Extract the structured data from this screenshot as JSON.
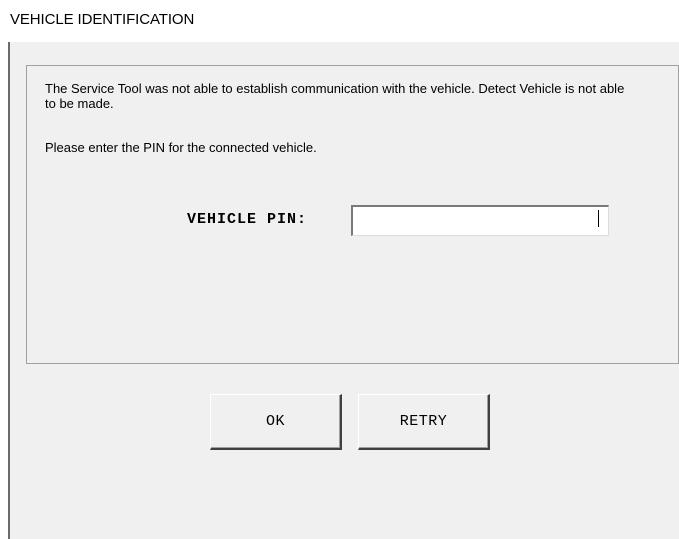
{
  "window": {
    "title": "VEHICLE IDENTIFICATION"
  },
  "message": {
    "line1": "The Service Tool was not able to establish communication with the vehicle. Detect Vehicle is not able to be made.",
    "line2": "Please enter the PIN for the connected vehicle."
  },
  "pin": {
    "label": "VEHICLE PIN:",
    "value": ""
  },
  "buttons": {
    "ok_label": "OK",
    "retry_label": "RETRY"
  },
  "colors": {
    "background": "#f0f0f0",
    "title_bar": "#ffffff",
    "input_background": "#ffffff",
    "text": "#000000"
  }
}
